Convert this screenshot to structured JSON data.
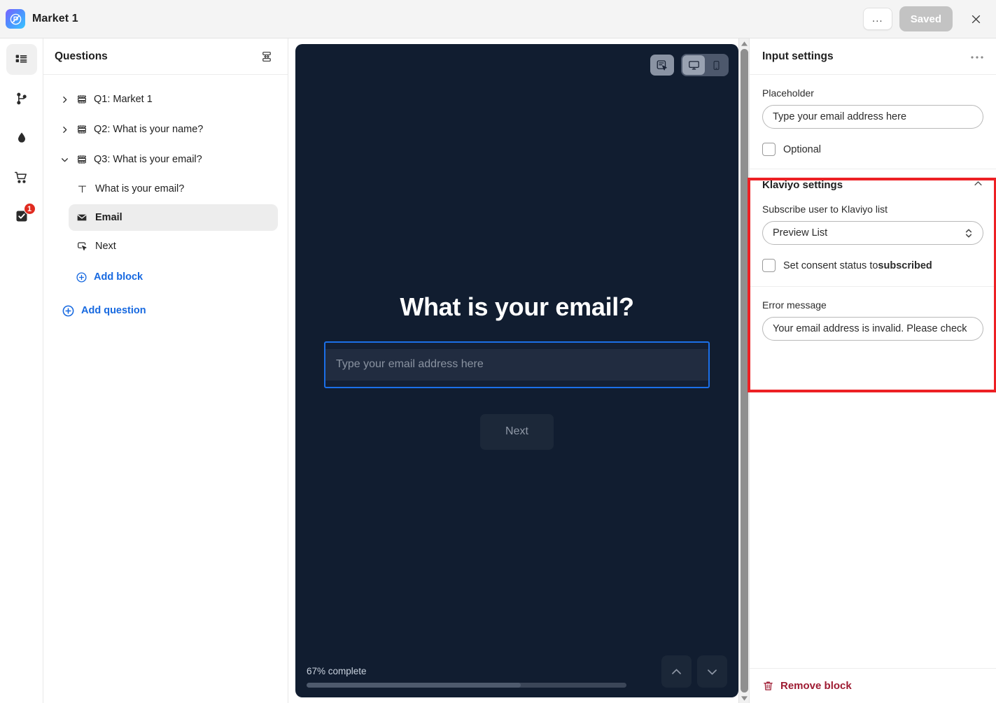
{
  "topbar": {
    "app_title": "Market 1",
    "logo_icon": "app-logo-icon",
    "ellipsis_label": "...",
    "saved_label": "Saved",
    "close_icon": "close-icon"
  },
  "rail": {
    "items": [
      {
        "icon": "list-blocks-icon",
        "name": "questions",
        "active": true,
        "badge": ""
      },
      {
        "icon": "git-fork-icon",
        "name": "logic",
        "active": false,
        "badge": ""
      },
      {
        "icon": "droplet-icon",
        "name": "theme",
        "active": false,
        "badge": ""
      },
      {
        "icon": "shopping-cart-icon",
        "name": "commerce",
        "active": false,
        "badge": ""
      },
      {
        "icon": "checkbox-icon",
        "name": "settings",
        "active": false,
        "badge": "1"
      }
    ]
  },
  "questions": {
    "title": "Questions",
    "collapse_icon": "collapse-all-icon",
    "items": [
      {
        "caret": "chevron-right-icon",
        "icon": "question-card-icon",
        "label": "Q1: Market 1",
        "expanded": false
      },
      {
        "caret": "chevron-right-icon",
        "icon": "question-card-icon",
        "label": "Q2: What is your name?",
        "expanded": false
      },
      {
        "caret": "chevron-down-icon",
        "icon": "question-card-icon",
        "label": "Q3: What is your email?",
        "expanded": true
      }
    ],
    "blocks": [
      {
        "icon": "text-icon",
        "label": "What is your email?",
        "selected": false
      },
      {
        "icon": "envelope-icon",
        "label": "Email",
        "selected": true
      },
      {
        "icon": "button-click-icon",
        "label": "Next",
        "selected": false
      }
    ],
    "add_block_label": "Add block",
    "add_question_label": "Add question",
    "add_icon": "plus-circle-icon",
    "accent_color": "#1769e0"
  },
  "preview": {
    "toolbar": [
      {
        "icon": "interactive-preview-icon",
        "name": "interactive-preview",
        "active": false
      },
      {
        "icon": "desktop-icon",
        "name": "desktop-view",
        "active": true
      },
      {
        "icon": "mobile-icon",
        "name": "mobile-view",
        "active": false
      }
    ],
    "question_text": "What is your email?",
    "input_placeholder": "Type your email address here",
    "next_label": "Next",
    "progress_label": "67% complete",
    "progress_percent": 67,
    "nav_up_icon": "chevron-up-icon",
    "nav_down_icon": "chevron-down-icon",
    "background_color": "#111d30",
    "selection_color": "#1b6fe8"
  },
  "settings": {
    "title": "Input settings",
    "menu_icon": "ellipsis-icon",
    "placeholder_label": "Placeholder",
    "placeholder_value": "Type your email address here",
    "optional_label": "Optional",
    "optional_checked": false,
    "klaviyo": {
      "title": "Klaviyo settings",
      "chevron_icon": "chevron-up-icon",
      "list_label": "Subscribe user to Klaviyo list",
      "list_value": "Preview List",
      "consent_label_prefix": "Set consent status to",
      "consent_label_strong": "subscribed",
      "consent_checked": false,
      "error_label": "Error message",
      "error_value": "Your email address is invalid. Please check",
      "highlight_color": "#ed2024"
    },
    "remove_block_label": "Remove block",
    "remove_icon": "trash-icon",
    "remove_color": "#9e1b32"
  }
}
